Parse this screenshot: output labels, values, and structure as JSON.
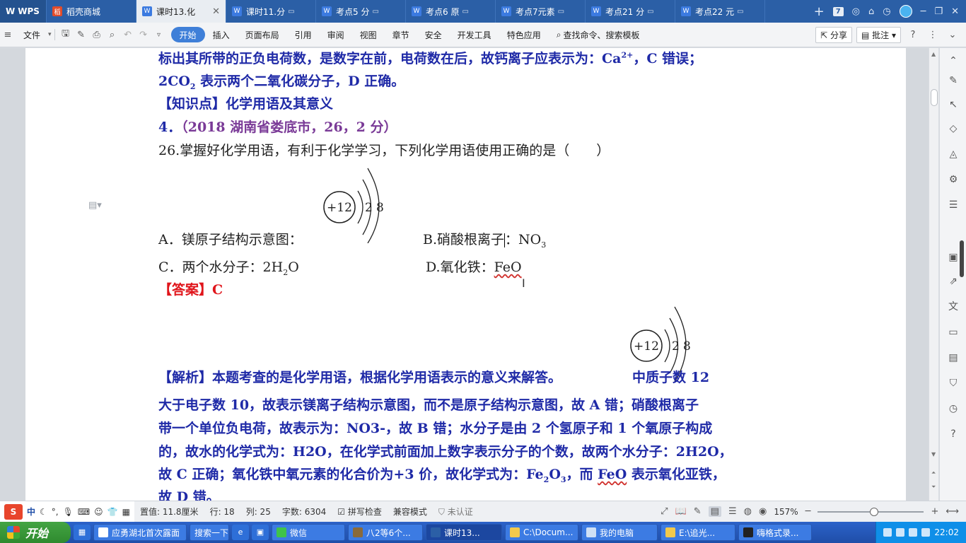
{
  "tabs": [
    {
      "label": "WPS",
      "icon": "wps-logo-icon"
    },
    {
      "label": "稻壳商城",
      "icon": "docer-icon"
    },
    {
      "label": "课时13.化",
      "icon": "doc-icon",
      "active": true
    },
    {
      "label": "课时11.分",
      "icon": "doc-icon"
    },
    {
      "label": "考点5 分",
      "icon": "doc-icon"
    },
    {
      "label": "考点6 原",
      "icon": "doc-icon"
    },
    {
      "label": "考点7元素",
      "icon": "doc-icon"
    },
    {
      "label": "考点21 分",
      "icon": "doc-icon"
    },
    {
      "label": "考点22 元",
      "icon": "doc-icon"
    }
  ],
  "tabbar": {
    "new_tab": "+",
    "count": "7"
  },
  "menu": {
    "file": "文件",
    "items": [
      "开始",
      "插入",
      "页面布局",
      "引用",
      "审阅",
      "视图",
      "章节",
      "安全",
      "开发工具",
      "特色应用"
    ],
    "search": "查找命令、搜索模板",
    "share": "分享",
    "comment": "批注",
    "help": "?"
  },
  "doc": {
    "line1": "标出其所带的正负电荷数，是数字在前，电荷数在后，故钙离子应表示为：Ca",
    "line1_sup": "2+",
    "line1_tail": "，C 错误；",
    "line2_a": "2CO",
    "line2_sub": "2",
    "line2_b": " 表示两个二氧化碳分子，D 正确。",
    "knowledge": "【知识点】化学用语及其意义",
    "q_num": "4．",
    "q_src": "（2018 湖南省娄底市，26，2 分）",
    "q_text": "26.掌握好化学用语，有利于化学学习，下列化学用语使用正确的是（　　）",
    "atom_nucleus": "+12",
    "atom_shell1": "2",
    "atom_shell2": "8",
    "optA": "A．镁原子结构示意图：",
    "optB_a": "B.硝酸根离子",
    "optB_b": "：NO",
    "optB_sub": "3",
    "optC_a": "C．两个水分子：2H",
    "optC_sub": "2",
    "optC_b": "O",
    "optD_a": "D.氧化铁：",
    "optD_b": "FeO",
    "answer": "【答案】C",
    "analysis_a": "【解析】本题考查的是化学用语，根据化学用语表示的意义来解答。",
    "analysis_b": "中质子数 12",
    "l2": "大于电子数 10，故表示镁离子结构示意图，而不是原子结构示意图，故 A 错；硝酸根离子",
    "l3": "带一个单位负电荷，故表示为：NO3-，故 B 错；水分子是由 2 个氢原子和 1 个氧原子构成",
    "l4": "的，故水的化学式为：H2O，在化学式前面加上数字表示分子的个数，故两个水分子：2H2O，",
    "l5_a": "故 C 正确；氧化铁中氧元素的化合价为+3 价，故化学式为：Fe",
    "l5_sub1": "2",
    "l5_b": "O",
    "l5_sub2": "3",
    "l5_c": "，而 ",
    "l5_d": "FeO",
    "l5_e": " 表示氧化亚铁，",
    "l6": "故 D 错。"
  },
  "status": {
    "position": "置值: 11.8厘米",
    "row": "行: 18",
    "col": "列: 25",
    "words": "字数: 6304",
    "spell": "拼写检查",
    "compat": "兼容模式",
    "cert": "未认证",
    "zoom": "157%",
    "ime_label": "中"
  },
  "taskbar": {
    "start": "开始",
    "items": [
      {
        "label": "应勇湖北首次露面"
      },
      {
        "label": "搜索一下"
      },
      {
        "label": "微信"
      },
      {
        "label": "八2等6个..."
      },
      {
        "label": "课时13...",
        "active": true
      },
      {
        "label": "C:\\Docum..."
      },
      {
        "label": "我的电脑"
      },
      {
        "label": "E:\\追光..."
      },
      {
        "label": "嗨格式录..."
      }
    ],
    "clock": "22:02"
  }
}
